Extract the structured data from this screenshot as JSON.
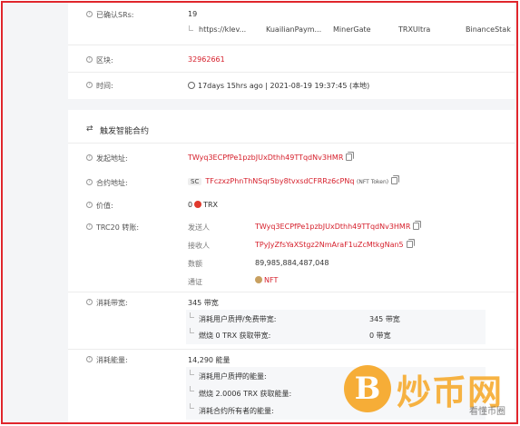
{
  "confirmed_srs": {
    "label": "已确认SRs:",
    "count": "19",
    "names": [
      "https://klev...",
      "KuaiIianPaym...",
      "MinerGate",
      "TRXUltra",
      "BinanceStak"
    ]
  },
  "block": {
    "label": "区块:",
    "value": "32962661"
  },
  "time": {
    "label": "时间:",
    "value": "17days 15hrs ago | 2021-08-19 19:37:45 (本地)"
  },
  "section": {
    "title": "触发智能合约"
  },
  "from_address": {
    "label": "发起地址:",
    "value": "TWyq3ECPfPe1pzbJUxDthh49TTqdNv3HMR"
  },
  "contract_address": {
    "label": "合约地址:",
    "tag": "SC",
    "value": "TFczxzPhnThNSqr5by8tvxsdCFRRz6cPNq",
    "note": "(NFT Token)"
  },
  "value": {
    "label": "价值:",
    "amount": "0",
    "unit": "TRX"
  },
  "trc20": {
    "label": "TRC20 转账:",
    "sender_label": "发送人",
    "sender": "TWyq3ECPfPe1pzbJUxDthh49TTqdNv3HMR",
    "receiver_label": "接收人",
    "receiver": "TPyJyZfsYaXStgz2NmAraF1uZcMtkgNan5",
    "amount_label": "数额",
    "amount": "89,985,884,487,048",
    "token_label": "通证",
    "token": "NFT"
  },
  "bandwidth": {
    "label": "消耗带宽:",
    "total": "345 带宽",
    "sub1_label": "消耗用户质押/免费带宽:",
    "sub1_value": "345 带宽",
    "sub2_label": "燃烧 0 TRX 获取带宽:",
    "sub2_value": "0 带宽"
  },
  "energy": {
    "label": "消耗能量:",
    "total": "14,290 能量",
    "sub1_label": "消耗用户质押的能量:",
    "sub2_label": "燃烧 2.0006 TRX 获取能量:",
    "sub3_label": "消耗合约所有者的能量:"
  },
  "watermark": {
    "coin": "B",
    "brand": "炒币网",
    "small": "看懂币圈"
  },
  "colors": {
    "border": "#e0262c",
    "accent_red": "#d6202c",
    "watermark": "#f6a623"
  }
}
